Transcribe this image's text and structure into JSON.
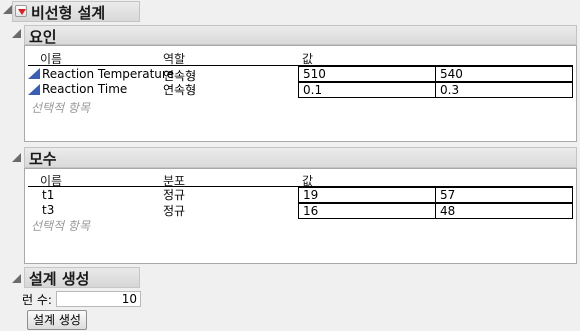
{
  "title": "비선형 설계",
  "factors": {
    "title": "요인",
    "columns": {
      "name": "이름",
      "role": "역할",
      "value": "값"
    },
    "rows": [
      {
        "name": "Reaction Temperature",
        "role": "연속형",
        "low": "510",
        "high": "540"
      },
      {
        "name": "Reaction Time",
        "role": "연속형",
        "low": "0.1",
        "high": "0.3"
      }
    ],
    "optional": "선택적 항목"
  },
  "parameters": {
    "title": "모수",
    "columns": {
      "name": "이름",
      "dist": "분포",
      "value": "값"
    },
    "rows": [
      {
        "name": "t1",
        "dist": "정규",
        "v1": "19",
        "v2": "57"
      },
      {
        "name": "t3",
        "dist": "정규",
        "v1": "16",
        "v2": "48"
      }
    ],
    "optional": "선택적 항목"
  },
  "design": {
    "title": "설계 생성",
    "runs_label": "런 수:",
    "runs_value": "10",
    "button_label": "설계 생성"
  },
  "colors": {
    "factor_icon": "#3a5fb0",
    "menu_arrow": "#d42020"
  }
}
